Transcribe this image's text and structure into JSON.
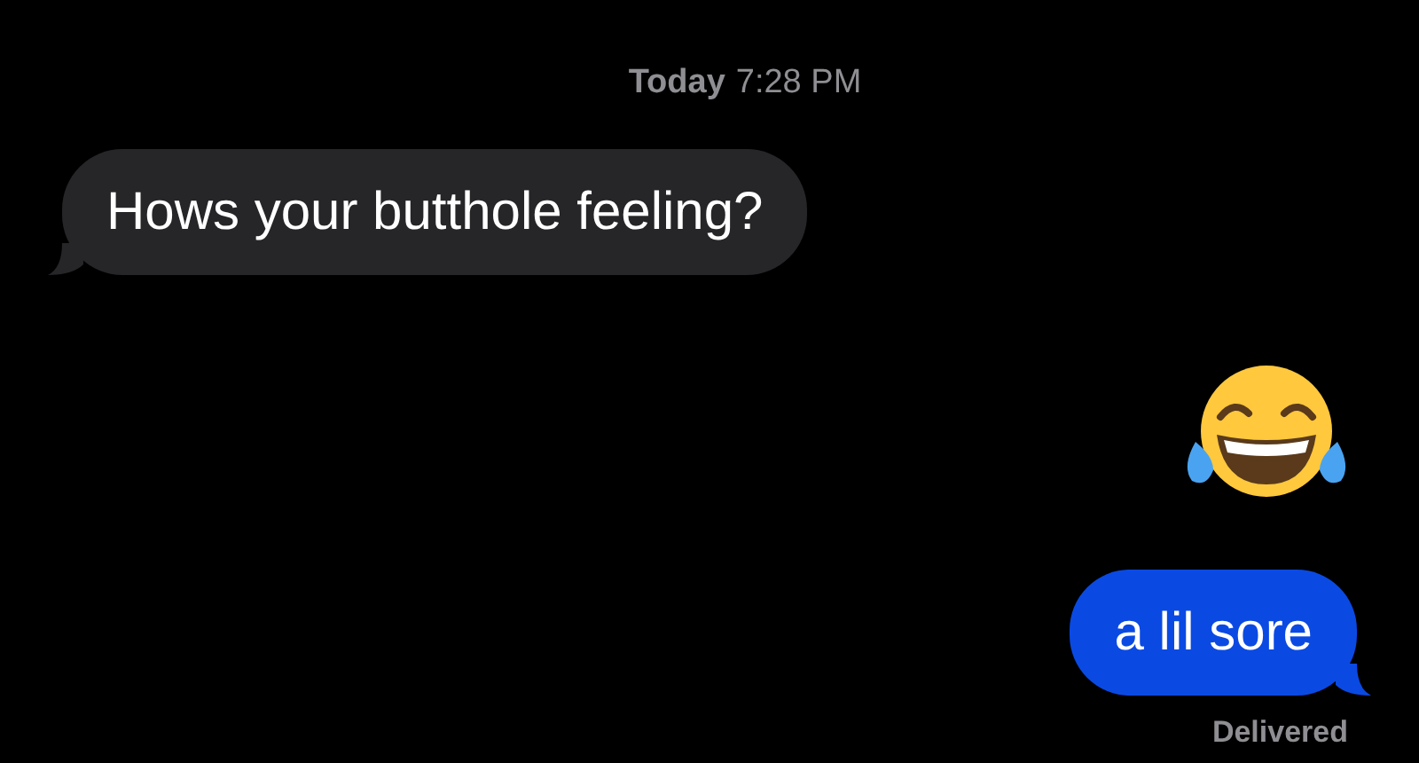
{
  "timestamp": {
    "day": "Today",
    "time": "7:28 PM"
  },
  "messages": [
    {
      "kind": "text",
      "sent": false,
      "text": "Hows your butthole feeling?"
    },
    {
      "kind": "emoji",
      "sent": true
    },
    {
      "kind": "text",
      "sent": true,
      "text": "a lil sore"
    }
  ],
  "receipt": "Delivered"
}
